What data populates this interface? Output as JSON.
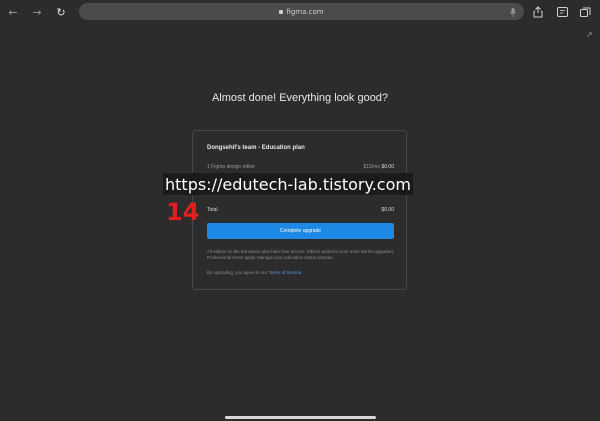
{
  "browser": {
    "url": "figma.com",
    "icons": {
      "back": "arrow-left-icon",
      "forward": "arrow-right-icon",
      "reload": "reload-icon",
      "lock": "lock-icon",
      "mic": "microphone-icon",
      "share": "share-icon",
      "reader": "reader-icon",
      "tabs": "tabs-icon"
    }
  },
  "page": {
    "heading": "Almost done! Everything look good?"
  },
  "card": {
    "title": "Dongsehil's team - Education plan",
    "line_item_label": "1 Figma design editor",
    "line_item_price_unit": "$15/mo",
    "line_item_price": "$0.00",
    "total_label": "Total",
    "total_value": "$0.00",
    "button_label": "Complete upgrade",
    "note": "All editors on the Education plan have free access. Editors added to your team will be upgraded. Professional terms apply. Manage your education status anytime.",
    "terms_prefix": "By upgrading, you agree to our",
    "terms_link": "Terms of Service."
  },
  "overlay": {
    "watermark": "https://edutech-lab.tistory.com",
    "number": "14"
  },
  "colors": {
    "background": "#2c2c2c",
    "accent": "#1e88e5",
    "stamp": "#e02020"
  }
}
